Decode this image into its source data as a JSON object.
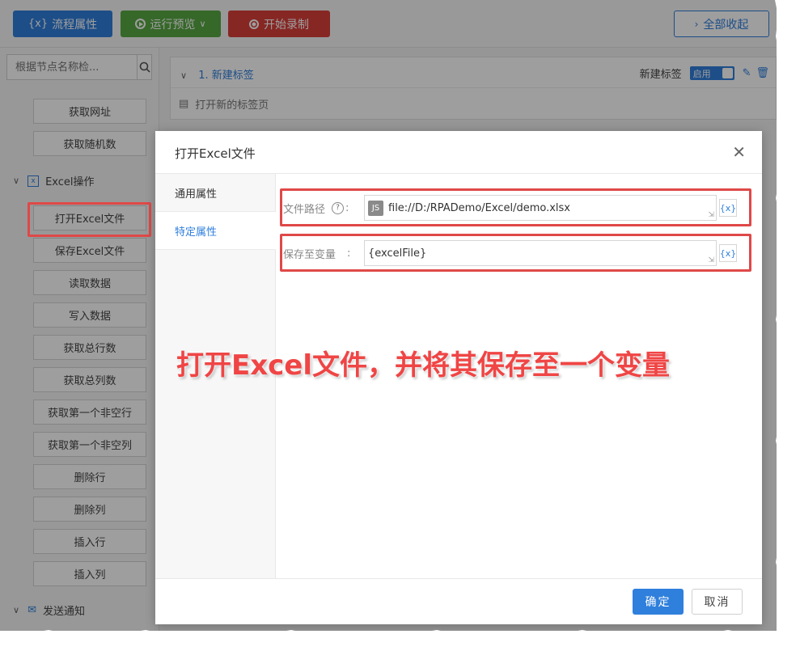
{
  "toolbar": {
    "flow_props": "流程属性",
    "flow_props_icon": "{x}",
    "run_preview": "运行预览",
    "start_record": "开始录制",
    "collapse_all": "全部收起"
  },
  "sidebar": {
    "search_placeholder": "根据节点名称检...",
    "items_top": [
      "获取网址",
      "获取随机数"
    ],
    "category_excel": "Excel操作",
    "excel_items": [
      "打开Excel文件",
      "保存Excel文件",
      "读取数据",
      "写入数据",
      "获取总行数",
      "获取总列数",
      "获取第一个非空行",
      "获取第一个非空列",
      "删除行",
      "删除列",
      "插入行",
      "插入列"
    ],
    "category_notify": "发送通知"
  },
  "node": {
    "title": "1. 新建标签",
    "right_label": "新建标签",
    "toggle_label": "启用",
    "subtitle": "打开新的标签页"
  },
  "dialog": {
    "title": "打开Excel文件",
    "tabs": [
      "通用属性",
      "特定属性"
    ],
    "active_tab": 1,
    "fields": {
      "file_path_label": "文件路径",
      "file_path_badge": "JS",
      "file_path_value": "file://D:/RPADemo/Excel/demo.xlsx",
      "save_var_label": "保存至变量",
      "save_var_value": "{excelFile}",
      "var_button": "{x}"
    },
    "ok": "确定",
    "cancel": "取消"
  },
  "annotation": "打开Excel文件，并将其保存至一个变量",
  "colors": {
    "primary": "#2f7fdc",
    "run_green": "#58a843",
    "record_red": "#d9403a",
    "highlight_red": "#e04848"
  }
}
